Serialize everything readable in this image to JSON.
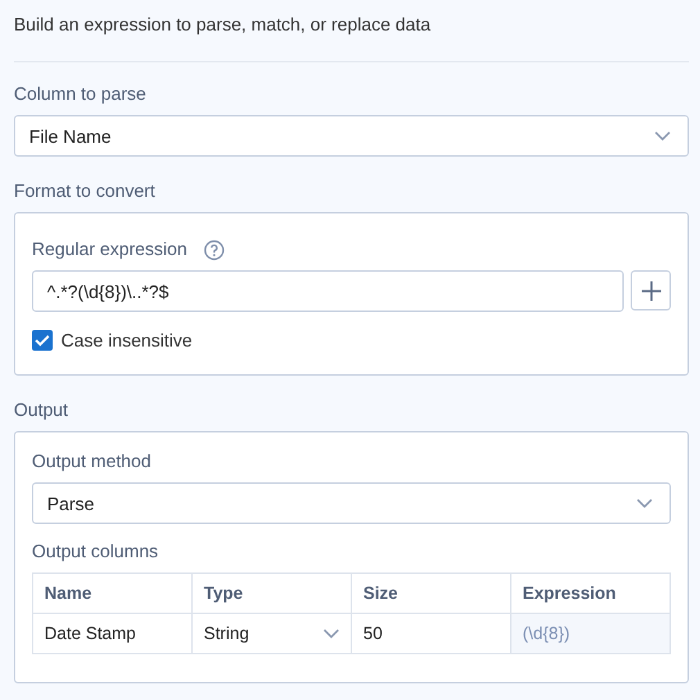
{
  "description": "Build an expression to parse, match, or replace data",
  "column_to_parse": {
    "label": "Column to parse",
    "value": "File Name"
  },
  "format_section": {
    "title": "Format to convert",
    "regex_label": "Regular expression",
    "regex_value": "^.*?(\\d{8})\\..*?$",
    "case_insensitive": {
      "label": "Case insensitive",
      "checked": true
    }
  },
  "output_section": {
    "title": "Output",
    "method": {
      "label": "Output method",
      "value": "Parse"
    },
    "columns_label": "Output columns",
    "table": {
      "columns": [
        "Name",
        "Type",
        "Size",
        "Expression"
      ],
      "rows": [
        {
          "name": "Date Stamp",
          "type": "String",
          "size": "50",
          "expression": "(\\d{8})"
        }
      ]
    }
  }
}
